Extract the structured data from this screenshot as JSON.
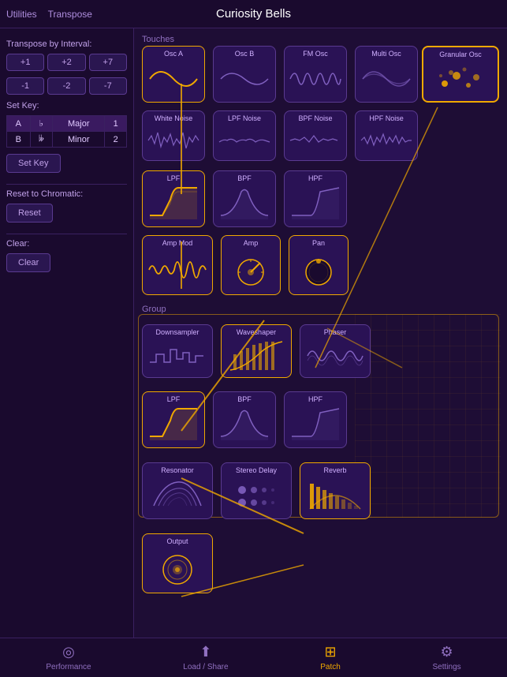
{
  "app": {
    "title": "Curiosity Bells",
    "nav": [
      "Utilities",
      "Transpose"
    ]
  },
  "sidebar": {
    "transpose_label": "Transpose by Interval:",
    "intervals_positive": [
      "+1",
      "+2",
      "+7"
    ],
    "intervals_negative": [
      "-1",
      "-2",
      "-7"
    ],
    "set_key_label": "Set Key:",
    "keys": [
      {
        "note": "A",
        "flat": "♭",
        "scale": "Major",
        "num": "1"
      },
      {
        "note": "B",
        "flat": "𝄫",
        "scale": "Minor",
        "num": "2"
      }
    ],
    "set_key_btn": "Set Key",
    "reset_label": "Reset to Chromatic:",
    "reset_btn": "Reset",
    "clear_label": "Clear:",
    "clear_btn": "Clear"
  },
  "touches_section": "Touches",
  "group_section": "Group",
  "nodes": {
    "osc_a": "Osc A",
    "osc_b": "Osc B",
    "fm_osc": "FM Osc",
    "multi_osc": "Multi Osc",
    "granular_osc": "Granular Osc",
    "white_noise": "White Noise",
    "lpf_noise": "LPF Noise",
    "bpf_noise": "BPF Noise",
    "hpf_noise": "HPF Noise",
    "lpf1": "LPF",
    "bpf1": "BPF",
    "hpf1": "HPF",
    "amp_mod": "Amp Mod",
    "amp": "Amp",
    "pan": "Pan",
    "downsampler": "Downsampler",
    "waveshaper": "Waveshaper",
    "phaser": "Phaser",
    "lpf2": "LPF",
    "bpf2": "BPF",
    "hpf2": "HPF",
    "resonator": "Resonator",
    "stereo_delay": "Stereo Delay",
    "reverb": "Reverb",
    "output": "Output"
  },
  "tabs": [
    {
      "label": "Performance",
      "icon": "◎",
      "active": false
    },
    {
      "label": "Load / Share",
      "icon": "⬆",
      "active": false
    },
    {
      "label": "Patch",
      "icon": "⊞",
      "active": true
    },
    {
      "label": "Settings",
      "icon": "⚙",
      "active": false
    }
  ],
  "colors": {
    "accent": "#f0a800",
    "bg": "#1a0a2e",
    "node_bg": "#2a1255",
    "border": "#5a3a90",
    "text": "#d0b0ff",
    "signal_line": "#f0a800"
  }
}
